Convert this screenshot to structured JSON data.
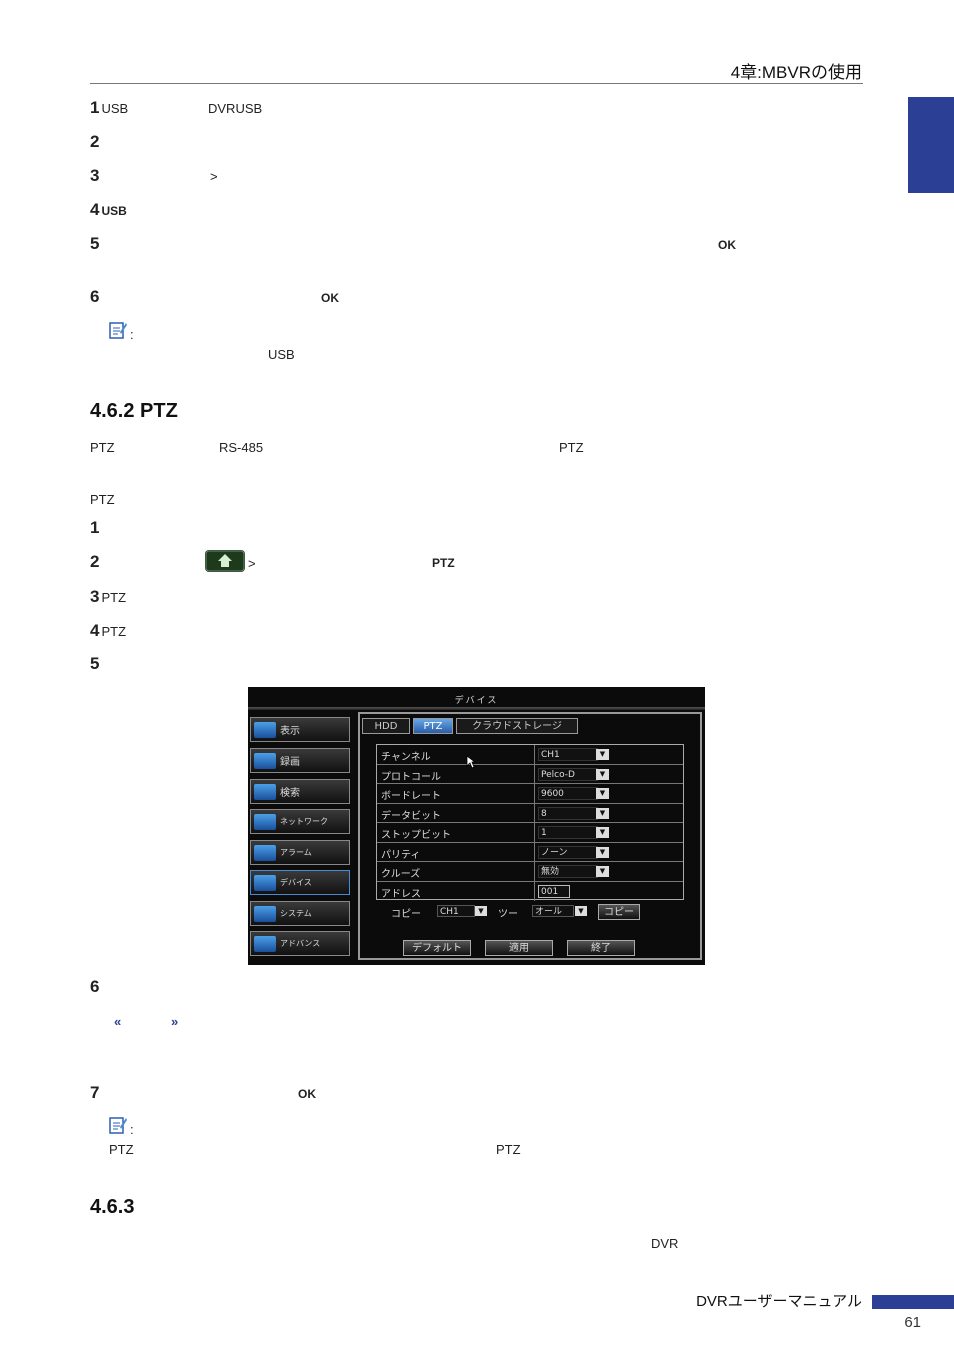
{
  "header": {
    "chapter": "4章:MBVRの使用"
  },
  "steps_top": [
    {
      "num": "1",
      "parts": [
        "USB",
        "DVRUSB"
      ]
    },
    {
      "num": "2"
    },
    {
      "num": "3",
      "parts": [
        ">"
      ]
    },
    {
      "num": "4",
      "parts": [
        "USB"
      ]
    },
    {
      "num": "5",
      "parts": [
        "OK"
      ]
    },
    {
      "num": "6",
      "parts": [
        "OK"
      ]
    }
  ],
  "note1": {
    "colon": ":",
    "text": "USB"
  },
  "section_ptz": {
    "heading": "4.6.2 PTZ",
    "para1": [
      "PTZ",
      "RS-485",
      "PTZ"
    ],
    "para2": "PTZ",
    "steps": [
      {
        "num": "1"
      },
      {
        "num": "2",
        "sep": ">",
        "bold": "PTZ"
      },
      {
        "num": "3",
        "text": "PTZ"
      },
      {
        "num": "4",
        "text": "PTZ"
      },
      {
        "num": "5"
      },
      {
        "num": "6"
      },
      {
        "num": "7",
        "bold": "OK"
      }
    ],
    "quotes": [
      "«",
      "»"
    ],
    "note2": {
      "colon": ":",
      "parts": [
        "PTZ",
        "PTZ"
      ]
    }
  },
  "dvr_screen": {
    "title": "デバイス",
    "menu": [
      "表示",
      "録画",
      "検索",
      "ネットワーク",
      "アラーム",
      "デバイス",
      "システム",
      "アドバンス"
    ],
    "tabs": [
      "HDD",
      "PTZ",
      "クラウドストレージ"
    ],
    "rows": [
      {
        "label": "チャンネル",
        "value": "CH1"
      },
      {
        "label": "プロトコール",
        "value": "Pelco-D"
      },
      {
        "label": "ボードレート",
        "value": "9600"
      },
      {
        "label": "データビット",
        "value": "8"
      },
      {
        "label": "ストップビット",
        "value": "1"
      },
      {
        "label": "パリティ",
        "value": "ノーン"
      },
      {
        "label": "クルーズ",
        "value": "無効"
      },
      {
        "label": "アドレス",
        "value": "001"
      }
    ],
    "copy": {
      "label": "コピー",
      "from": "CH1",
      "to_label": "ツー",
      "to": "オール",
      "button": "コピー"
    },
    "buttons": [
      "デフォルト",
      "適用",
      "終了"
    ]
  },
  "section_463": {
    "heading": "4.6.3",
    "text": "DVR"
  },
  "footer": {
    "title": "DVRユーザーマニュアル",
    "page": "61"
  },
  "colors": {
    "accent": "#2b3f95"
  }
}
